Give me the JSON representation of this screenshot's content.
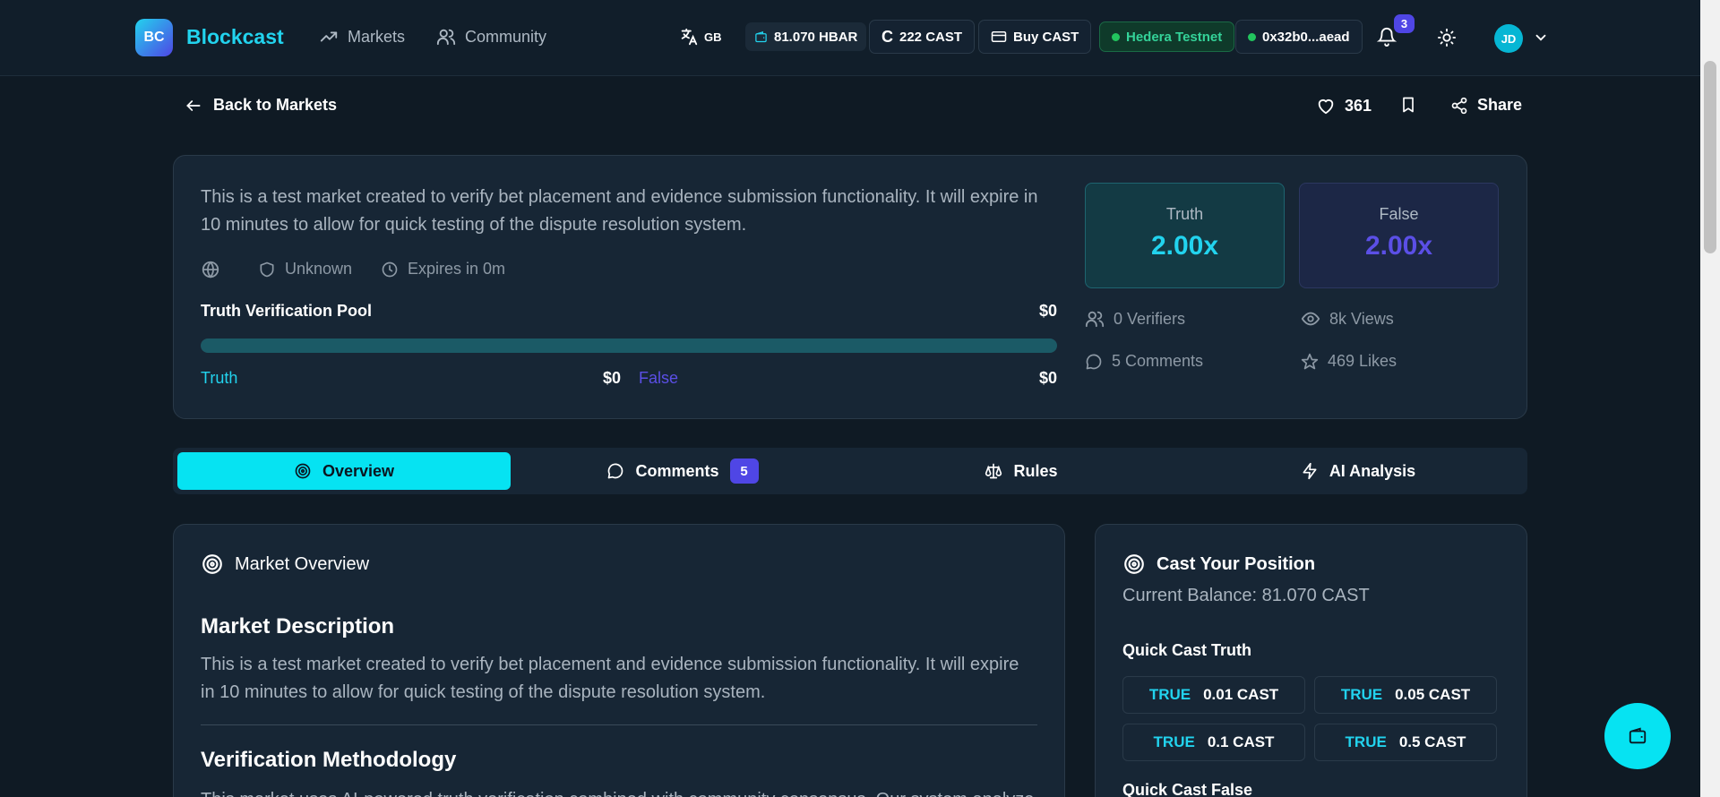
{
  "header": {
    "logo_text": "BC",
    "brand": "Blockcast",
    "nav": [
      {
        "label": "Markets",
        "icon": "trending-up-icon"
      },
      {
        "label": "Community",
        "icon": "users-icon"
      }
    ],
    "lang": "GB",
    "hbar_balance": "81.070 HBAR",
    "cast_balance": "222 CAST",
    "buy_label": "Buy CAST",
    "network": "Hedera Testnet",
    "wallet": "0x32b0...aead",
    "notification_count": "3",
    "avatar_initials": "JD"
  },
  "actions": {
    "back_label": "Back to Markets",
    "likes": "361",
    "share_label": "Share"
  },
  "market": {
    "description": "This is a test market created to verify bet placement and evidence submission functionality. It will expire in 10 minutes to allow for quick testing of the dispute resolution system.",
    "category": "Unknown",
    "expires": "Expires in 0m",
    "pool_title": "Truth Verification Pool",
    "pool_total": "$0",
    "pool_fraction": 1.0,
    "truth_label": "Truth",
    "truth_amount": "$0",
    "false_label": "False",
    "false_amount": "$0",
    "truth_odds_label": "Truth",
    "truth_odds": "2.00x",
    "false_odds_label": "False",
    "false_odds": "2.00x",
    "verifiers": "0 Verifiers",
    "views": "8k Views",
    "comments": "5 Comments",
    "likes_stat": "469 Likes"
  },
  "tabs": [
    {
      "label": "Overview",
      "icon": "target-icon"
    },
    {
      "label": "Comments",
      "icon": "message-circle-icon",
      "count": "5"
    },
    {
      "label": "Rules",
      "icon": "scale-icon"
    },
    {
      "label": "AI Analysis",
      "icon": "zap-icon"
    }
  ],
  "overview": {
    "section_title": "Market Overview",
    "desc_heading": "Market Description",
    "desc_text": "This is a test market created to verify bet placement and evidence submission functionality. It will expire in 10 minutes to allow for quick testing of the dispute resolution system.",
    "method_heading": "Verification Methodology",
    "method_text": "This market uses AI-powered truth verification combined with community consensus. Our system analyzes"
  },
  "cast": {
    "title": "Cast Your Position",
    "balance": "Current Balance: 81.070 CAST",
    "truth_heading": "Quick Cast Truth",
    "true_tag": "TRUE",
    "amounts": [
      "0.01 CAST",
      "0.05 CAST",
      "0.1 CAST",
      "0.5 CAST"
    ],
    "false_heading": "Quick Cast False"
  },
  "colors": {
    "accent": "#22d3ee",
    "false": "#5b4fe6",
    "background": "#0f1a24",
    "card": "#172635"
  }
}
